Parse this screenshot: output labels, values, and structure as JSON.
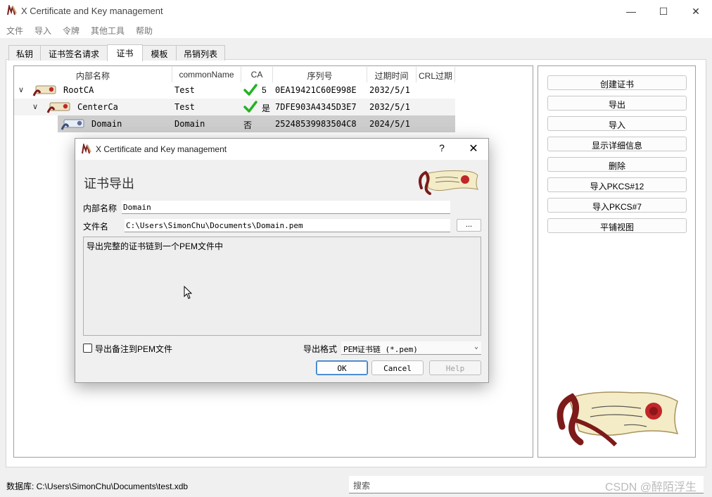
{
  "window": {
    "title": "X Certificate and Key management",
    "minimize": "—",
    "maximize": "☐",
    "close": "✕"
  },
  "menu": [
    "文件",
    "导入",
    "令牌",
    "其他工具",
    "帮助"
  ],
  "tabs": [
    "私钥",
    "证书签名请求",
    "证书",
    "模板",
    "吊销列表"
  ],
  "active_tab": "证书",
  "columns": [
    "内部名称",
    "commonName",
    "CA",
    "序列号",
    "过期时间",
    "CRL过期"
  ],
  "rows": [
    {
      "name": "RootCA",
      "common": "Test",
      "ca": "5",
      "ca_check": true,
      "serial": "0EA19421C60E998E",
      "expiry": "2032/5/1",
      "crl": ""
    },
    {
      "name": "CenterCa",
      "common": "Test",
      "ca": "是",
      "ca_check": true,
      "serial": "7DFE903A4345D3E7",
      "expiry": "2032/5/1",
      "crl": ""
    },
    {
      "name": "Domain",
      "common": "Domain",
      "ca": "否",
      "ca_check": false,
      "serial": "25248539983504C8",
      "expiry": "2024/5/1",
      "crl": ""
    }
  ],
  "side_buttons": [
    "创建证书",
    "导出",
    "导入",
    "显示详细信息",
    "删除",
    "导入PKCS#12",
    "导入PKCS#7",
    "平铺视图"
  ],
  "status": {
    "db": "数据库: C:\\Users\\SimonChu\\Documents\\test.xdb",
    "search_placeholder": "搜索",
    "watermark": "CSDN @醉陌浮生"
  },
  "dialog": {
    "title": "X Certificate and Key management",
    "help": "?",
    "close": "✕",
    "heading": "证书导出",
    "internal_name_label": "内部名称",
    "internal_name_value": "Domain",
    "filename_label": "文件名",
    "filename_value": "C:\\Users\\SimonChu\\Documents\\Domain.pem",
    "browse": "...",
    "description": "导出完整的证书链到一个PEM文件中",
    "export_comment_label": "导出备注到PEM文件",
    "export_comment_checked": false,
    "format_label": "导出格式",
    "format_value": "PEM证书链 (*.pem)",
    "ok": "OK",
    "cancel": "Cancel",
    "help_button": "Help"
  },
  "colors": {
    "selected_row": "#cdcdcd",
    "check_green": "#22b322",
    "default_button_border": "#2f76c9"
  }
}
